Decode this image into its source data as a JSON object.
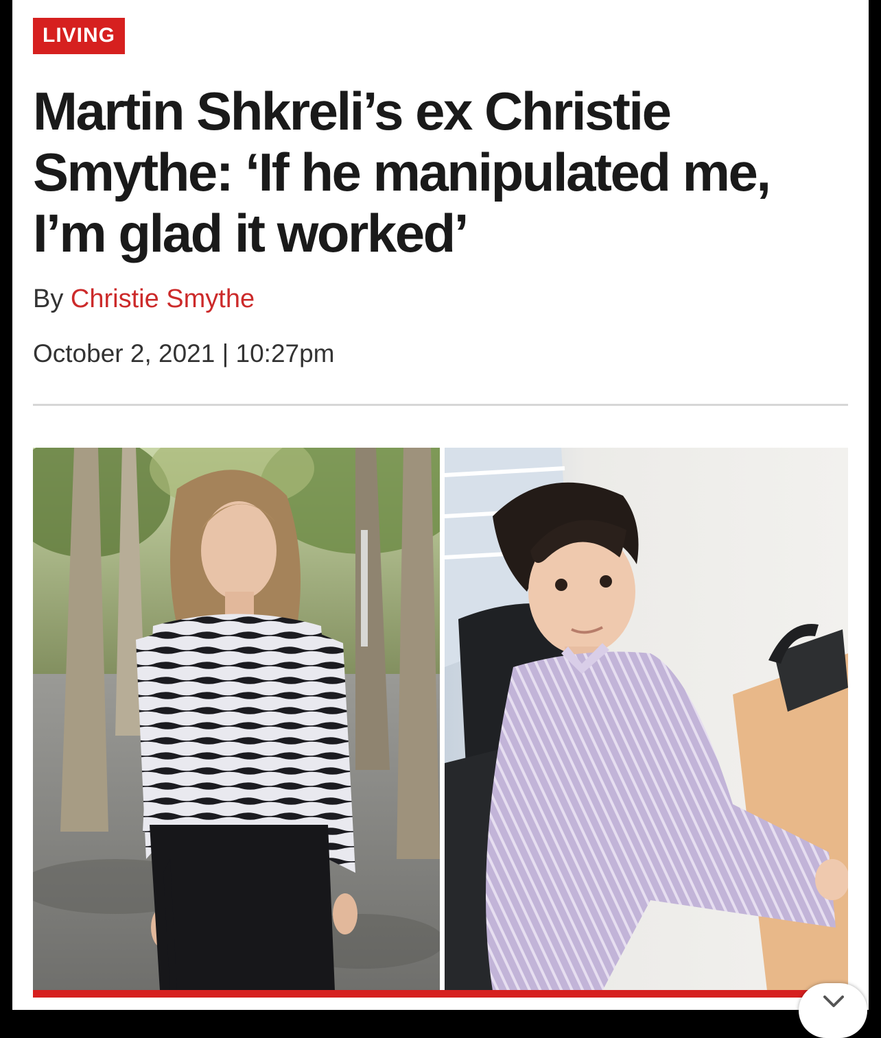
{
  "article": {
    "section": "LIVING",
    "headline": "Martin Shkreli’s ex Christie Smythe: ‘If he manipulated me, I’m glad it worked’",
    "byline_prefix": "By ",
    "author": "Christie Smythe",
    "date": "October 2, 2021 | 10:27pm"
  },
  "colors": {
    "brand_red": "#d6201f",
    "author_link": "#cc2a2a",
    "headline": "#1a1a1a"
  },
  "icons": {
    "collapse": "chevron-down-icon"
  }
}
